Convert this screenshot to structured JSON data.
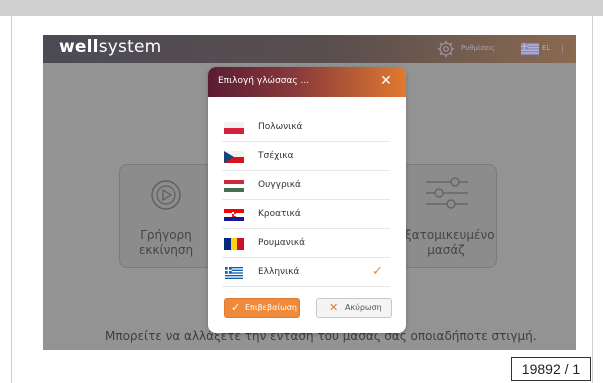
{
  "appbar": {
    "logo_bold": "well",
    "logo_rest": "system",
    "settings_label": "Ρυθμίσεις",
    "language_code": "EL",
    "separator": "|"
  },
  "cards": {
    "quick_start": {
      "line1": "Γρήγορη",
      "line2": "εκκίνηση"
    },
    "custom": {
      "line1": "Εξατομικευμένο",
      "line2": "μασάζ"
    }
  },
  "hint": "Μπορείτε να αλλάξετε την ένταση του μασάζ σας οποιαδήποτε στιγμή.",
  "dialog": {
    "title": "Επιλογή γλώσσας ...",
    "close_symbol": "✕",
    "languages": [
      {
        "label": "Πολωνικά",
        "flag": "flag-poland",
        "selected": false
      },
      {
        "label": "Τσέχικα",
        "flag": "flag-czech",
        "selected": false
      },
      {
        "label": "Ουγγρικά",
        "flag": "flag-hungary",
        "selected": false
      },
      {
        "label": "Κροατικά",
        "flag": "flag-croatia",
        "selected": false
      },
      {
        "label": "Ρουμανικά",
        "flag": "flag-romania",
        "selected": false
      },
      {
        "label": "Ελληνικά",
        "flag": "flag-greece",
        "selected": true
      }
    ],
    "check_symbol": "✓",
    "confirm_label": "Επιβεβαίωση",
    "confirm_icon": "✓",
    "cancel_label": "Ακύρωση",
    "cancel_icon": "✕"
  },
  "doc_ref": "19892 / 1",
  "colors": {
    "accent": "#ef8a3c",
    "header_dark": "#5a1c34",
    "overlay": "#939393"
  }
}
